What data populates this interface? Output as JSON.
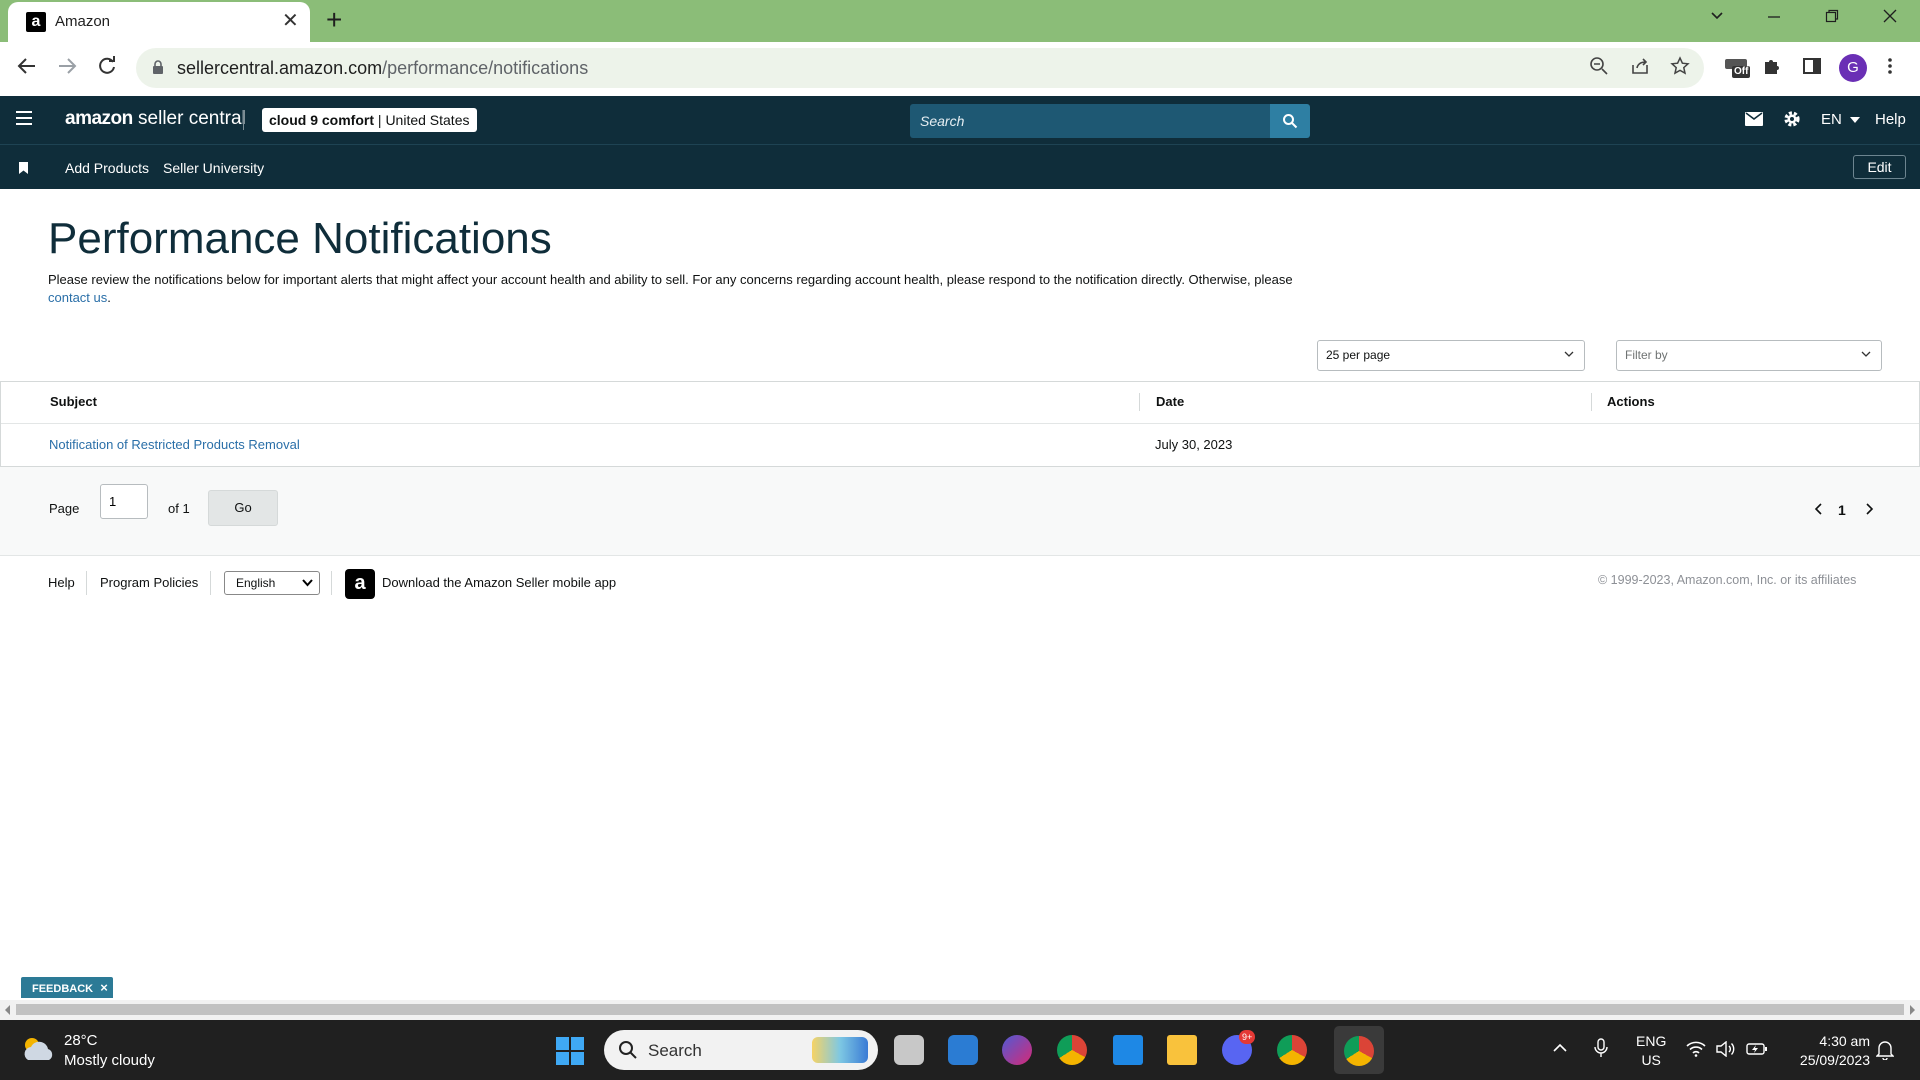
{
  "browser": {
    "tab_title": "Amazon",
    "tab_favicon": "a",
    "tab_close": "✕",
    "new_tab": "+",
    "url_domain": "sellercentral.amazon.com",
    "url_path": "/performance/notifications",
    "extension_badge": "Off",
    "profile_initial": "G"
  },
  "header": {
    "logo_amazon": "amazon",
    "logo_rest": " seller central",
    "store_name": "cloud 9 comfort",
    "store_separator": " | ",
    "store_region": "United States",
    "search_placeholder": "Search",
    "language": "EN",
    "help": "Help"
  },
  "subnav": {
    "links": [
      "Add Products",
      "Seller University"
    ],
    "edit": "Edit"
  },
  "page": {
    "title": "Performance Notifications",
    "intro_text": "Please review the notifications below for important alerts that might affect your account health and ability to sell. For any concerns regarding account health, please respond to the notification directly. Otherwise, please ",
    "intro_link": "contact us",
    "intro_end": "."
  },
  "filters": {
    "per_page": "25 per page",
    "filter_placeholder": "Filter by"
  },
  "table": {
    "columns": [
      "Subject",
      "Date",
      "Actions"
    ],
    "rows": [
      {
        "subject": "Notification of Restricted Products Removal",
        "date": "July 30, 2023",
        "actions": ""
      }
    ]
  },
  "pagination": {
    "page_label": "Page",
    "page_value": "1",
    "of_label": "of 1",
    "go": "Go",
    "current": "1"
  },
  "footer": {
    "help": "Help",
    "policies": "Program Policies",
    "language": "English",
    "app_icon": "a",
    "app_text": "Download the Amazon Seller mobile app",
    "copyright": "© 1999-2023, Amazon.com, Inc. or its affiliates"
  },
  "feedback": {
    "label": "FEEDBACK",
    "close": "×"
  },
  "taskbar": {
    "temperature": "28°C",
    "weather": "Mostly cloudy",
    "search_label": "Search",
    "discord_badge": "9+",
    "lang_line1": "ENG",
    "lang_line2": "US",
    "time": "4:30 am",
    "date": "25/09/2023"
  },
  "colors": {
    "tabbar": "#8bbd78",
    "header": "#0f2d3a",
    "link": "#2a6fa8",
    "search_button": "#2e7fa3",
    "feedback": "#2c7a96"
  }
}
